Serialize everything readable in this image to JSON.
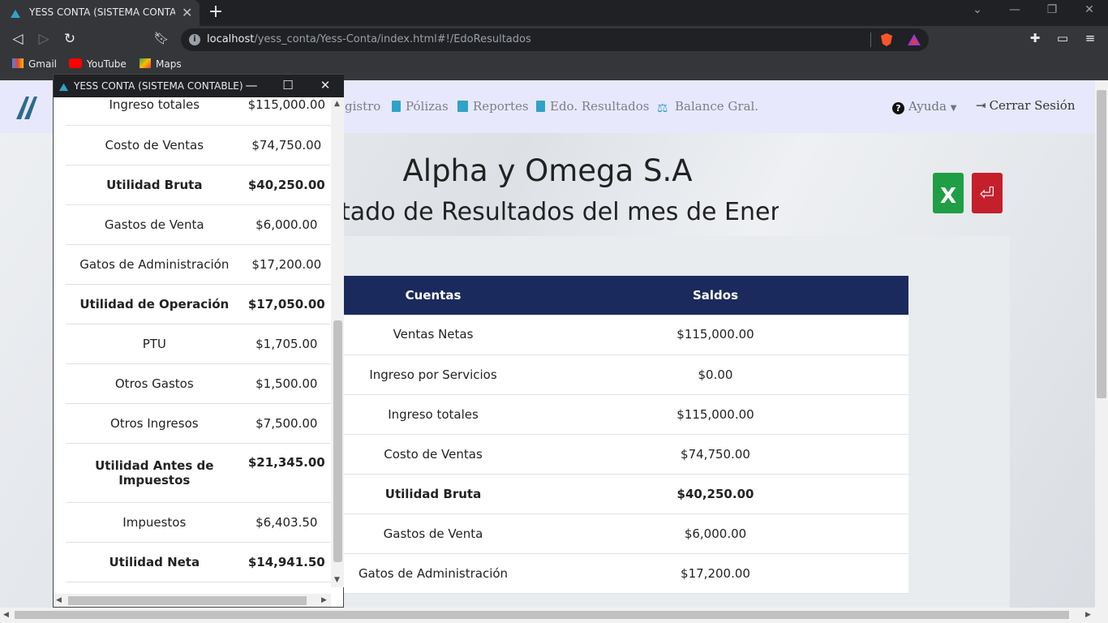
{
  "browser": {
    "tab_title": "YESS CONTA (SISTEMA CONTABLE)",
    "url_host": "localhost",
    "url_path": "/yess_conta/Yess-Conta/index.html#!/EdoResultados",
    "bookmarks": [
      "Gmail",
      "YouTube",
      "Maps"
    ]
  },
  "navbar": {
    "links": [
      "gistro",
      "Pólizas",
      "Reportes",
      "Edo. Resultados",
      "Balance Gral."
    ],
    "help_label": "Ayuda",
    "logout_label": "Cerrar Sesión"
  },
  "report": {
    "company": "Alpha y Omega S.A",
    "subtitle": "tado de Resultados del mes de Enero",
    "col_accounts": "Cuentas",
    "col_balances": "Saldos",
    "rows": [
      {
        "account": "Ventas Netas",
        "balance": "$115,000.00"
      },
      {
        "account": "Ingreso por Servicios",
        "balance": "$0.00"
      },
      {
        "account": "Ingreso totales",
        "balance": "$115,000.00"
      },
      {
        "account": "Costo de Ventas",
        "balance": "$74,750.00"
      },
      {
        "account": "Utilidad Bruta",
        "balance": "$40,250.00"
      },
      {
        "account": "Gastos de Venta",
        "balance": "$6,000.00"
      },
      {
        "account": "Gatos de Administración",
        "balance": "$17,200.00"
      }
    ]
  },
  "popup": {
    "title": "YESS CONTA (SISTEMA CONTABLE)",
    "rows": [
      {
        "account": "Ingreso totales",
        "balance": "$115,000.00"
      },
      {
        "account": "Costo de Ventas",
        "balance": "$74,750.00"
      },
      {
        "account": "Utilidad Bruta",
        "balance": "$40,250.00"
      },
      {
        "account": "Gastos de Venta",
        "balance": "$6,000.00"
      },
      {
        "account": "Gatos de Administración",
        "balance": "$17,200.00"
      },
      {
        "account": "Utilidad de Operación",
        "balance": "$17,050.00"
      },
      {
        "account": "PTU",
        "balance": "$1,705.00"
      },
      {
        "account": "Otros Gastos",
        "balance": "$1,500.00"
      },
      {
        "account": "Otros Ingresos",
        "balance": "$7,500.00"
      },
      {
        "account": "Utilidad Antes de Impuestos",
        "balance": "$21,345.00"
      },
      {
        "account": "Impuestos",
        "balance": "$6,403.50"
      },
      {
        "account": "Utilidad Neta",
        "balance": "$14,941.50"
      }
    ]
  }
}
